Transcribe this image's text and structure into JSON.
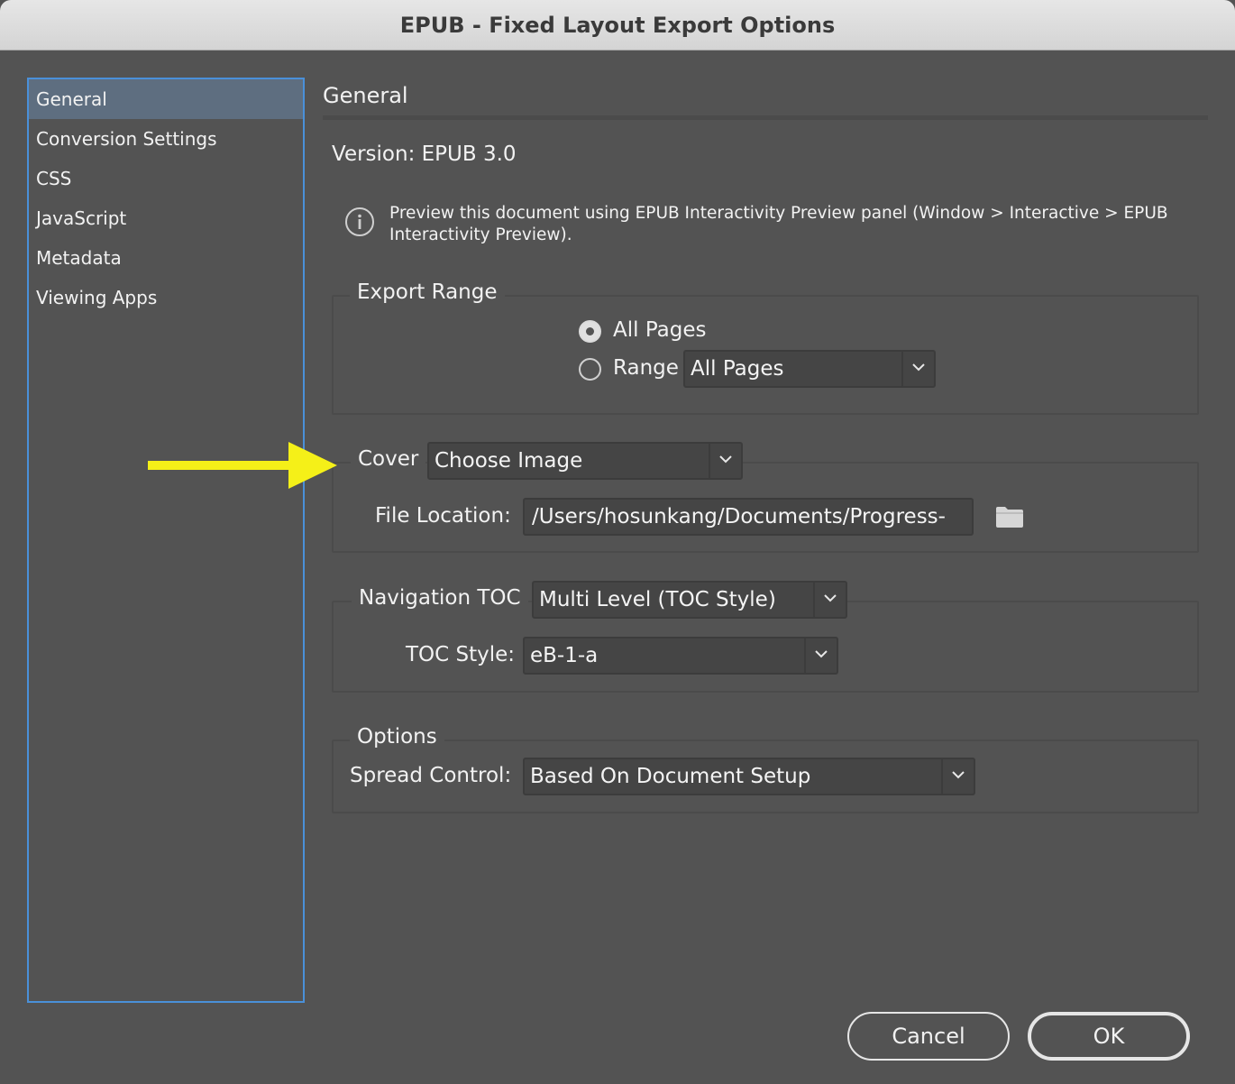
{
  "window": {
    "title": "EPUB - Fixed Layout Export Options"
  },
  "sidebar": {
    "items": [
      {
        "label": "General",
        "selected": true
      },
      {
        "label": "Conversion Settings",
        "selected": false
      },
      {
        "label": "CSS",
        "selected": false
      },
      {
        "label": "JavaScript",
        "selected": false
      },
      {
        "label": "Metadata",
        "selected": false
      },
      {
        "label": "Viewing Apps",
        "selected": false
      }
    ]
  },
  "main": {
    "title": "General",
    "version": "Version: EPUB 3.0",
    "info": "Preview this document using EPUB Interactivity Preview panel (Window > Interactive > EPUB Interactivity Preview).",
    "export_range": {
      "legend": "Export Range",
      "all_pages_label": "All Pages",
      "range_label": "Range",
      "range_value": "All Pages",
      "selected": "All Pages"
    },
    "cover": {
      "legend": "Cover",
      "value": "Choose Image",
      "file_location_label": "File Location:",
      "file_location_value": "/Users/hosunkang/Documents/Progress-"
    },
    "navigation": {
      "legend": "Navigation TOC",
      "value": "Multi Level (TOC Style)",
      "toc_style_label": "TOC Style:",
      "toc_style_value": "eB-1-a"
    },
    "options": {
      "legend": "Options",
      "spread_label": "Spread Control:",
      "spread_value": "Based On Document Setup"
    }
  },
  "buttons": {
    "cancel": "Cancel",
    "ok": "OK"
  },
  "colors": {
    "accent": "#4a90d9",
    "annotation_arrow": "#f5f018",
    "panel_bg": "#535353"
  }
}
